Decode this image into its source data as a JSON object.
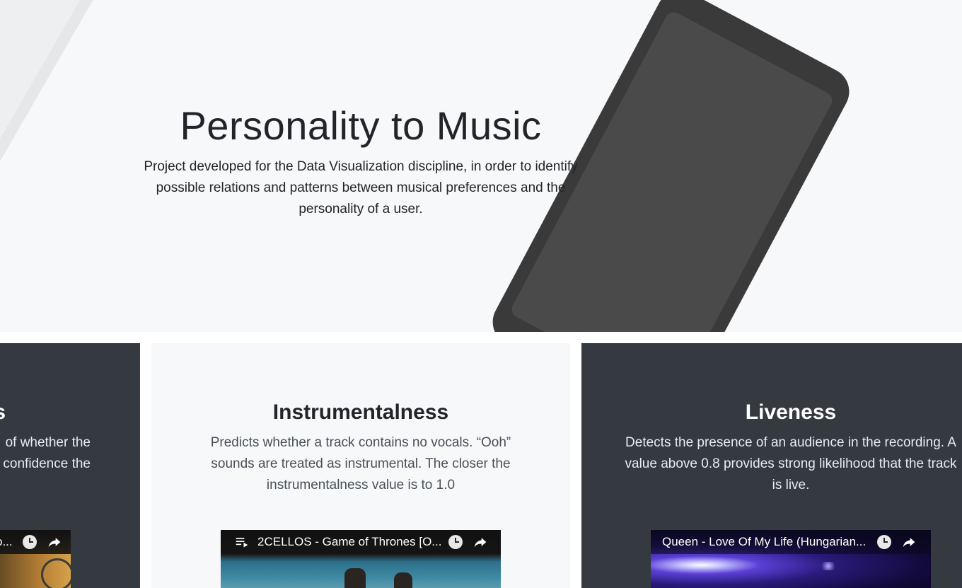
{
  "hero": {
    "title": "Personality to Music",
    "description": "Project developed for the Data Visualization discipline, in order to identify possible relations and patterns between musical preferences and the personality of a user."
  },
  "cards": [
    {
      "title": "s",
      "description_fragment_1": "of whether the",
      "description_fragment_2": "confidence the",
      "video": {
        "title": "o..."
      }
    },
    {
      "title": "Instrumentalness",
      "description": "Predicts whether a track contains no vocals. “Ooh” sounds are treated as instrumental. The closer the instrumentalness value is to 1.0",
      "video": {
        "title": "2CELLOS - Game of Thrones [O..."
      }
    },
    {
      "title": "Liveness",
      "description": "Detects the presence of an audience in the recording. A value above 0.8 provides strong likelihood that the track is live.",
      "video": {
        "title": "Queen - Love Of My Life (Hungarian..."
      }
    }
  ],
  "colors": {
    "dark_card": "#343a40",
    "light_bg": "#f7f8fa",
    "phone": "#3a3a3b"
  },
  "icons": {
    "playlist": "playlist-icon",
    "watch_later": "clock-icon",
    "share": "share-icon"
  }
}
